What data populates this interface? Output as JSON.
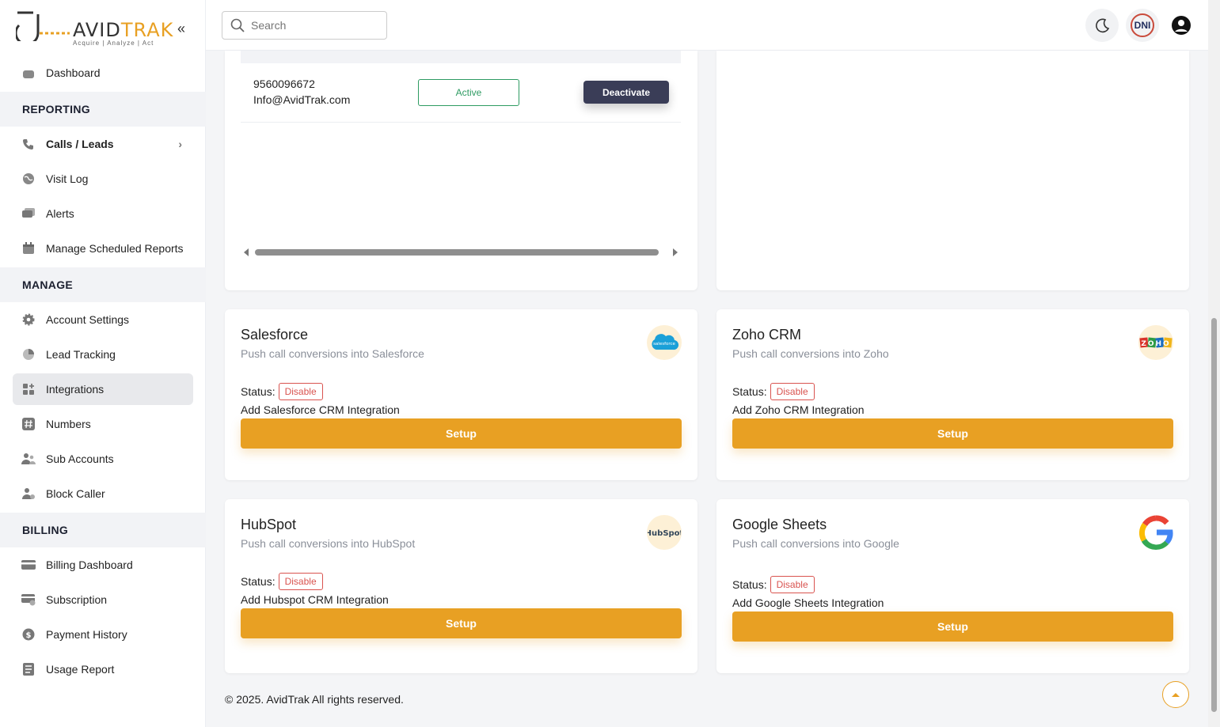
{
  "brand": {
    "wordmark_a": "AVID",
    "wordmark_b": "TRAK",
    "tagline": "Acquire  |  Analyze  |  Act"
  },
  "colors": {
    "accent": "#e8a023",
    "dark_button": "#3a3d57",
    "active_green": "#2e9b62",
    "disable_red": "#d9534f"
  },
  "sidebar": {
    "items": [
      {
        "label": "Dashboard",
        "icon": "home-icon"
      },
      {
        "section": "REPORTING"
      },
      {
        "label": "Calls / Leads",
        "icon": "phone-icon"
      },
      {
        "label": "Visit Log",
        "icon": "globe-icon"
      },
      {
        "label": "Alerts",
        "icon": "chat-icon"
      },
      {
        "label": "Manage Scheduled Reports",
        "icon": "calendar-icon"
      },
      {
        "section": "MANAGE"
      },
      {
        "label": "Account Settings",
        "icon": "gear-icon"
      },
      {
        "label": "Lead Tracking",
        "icon": "pie-chart-icon"
      },
      {
        "label": "Integrations",
        "icon": "grid-plus-icon"
      },
      {
        "label": "Numbers",
        "icon": "hash-icon"
      },
      {
        "label": "Sub Accounts",
        "icon": "users-icon"
      },
      {
        "label": "Block Caller",
        "icon": "user-block-icon"
      },
      {
        "section": "BILLING"
      },
      {
        "label": "Billing Dashboard",
        "icon": "card-icon"
      },
      {
        "label": "Subscription",
        "icon": "card-refresh-icon"
      },
      {
        "label": "Payment History",
        "icon": "dollar-icon"
      },
      {
        "label": "Usage Report",
        "icon": "report-icon"
      }
    ]
  },
  "header": {
    "search_placeholder": "Search",
    "dni_label": "DNI"
  },
  "contact_table": {
    "phone": "9560096672",
    "email": "Info@AvidTrak.com",
    "status": "Active",
    "action": "Deactivate"
  },
  "integrations": [
    {
      "title": "Salesforce",
      "subtitle": "Push call conversions into Salesforce",
      "status_label": "Status:",
      "status": "Disable",
      "add_label": "Add Salesforce CRM Integration",
      "button": "Setup",
      "logo_text": "salesforce"
    },
    {
      "title": "Zoho CRM",
      "subtitle": "Push call conversions into Zoho",
      "status_label": "Status:",
      "status": "Disable",
      "add_label": "Add Zoho CRM Integration",
      "button": "Setup",
      "logo_text": "ZOHO"
    },
    {
      "title": "HubSpot",
      "subtitle": "Push call conversions into HubSpot",
      "status_label": "Status:",
      "status": "Disable",
      "add_label": "Add Hubspot CRM Integration",
      "button": "Setup",
      "logo_text": "HubSpot"
    },
    {
      "title": "Google Sheets",
      "subtitle": "Push call conversions into Google",
      "status_label": "Status:",
      "status": "Disable",
      "add_label": "Add Google Sheets Integration",
      "button": "Setup",
      "logo_text": "G"
    }
  ],
  "footer": {
    "copyright": "© 2025. AvidTrak All rights reserved."
  }
}
